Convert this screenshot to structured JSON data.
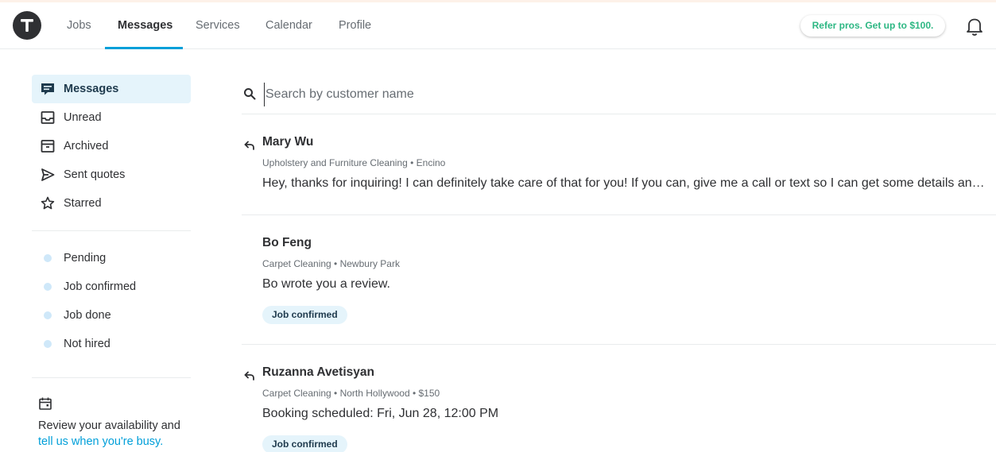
{
  "header": {
    "logo_letter": "T",
    "nav": [
      {
        "label": "Jobs",
        "active": false
      },
      {
        "label": "Messages",
        "active": true
      },
      {
        "label": "Services",
        "active": false
      },
      {
        "label": "Calendar",
        "active": false
      },
      {
        "label": "Profile",
        "active": false
      }
    ],
    "refer_label": "Refer pros. Get up to $100.",
    "bell_icon": "bell-icon"
  },
  "sidebar": {
    "folders": [
      {
        "label": "Messages",
        "icon": "message-icon",
        "active": true
      },
      {
        "label": "Unread",
        "icon": "inbox-icon",
        "active": false
      },
      {
        "label": "Archived",
        "icon": "archive-icon",
        "active": false
      },
      {
        "label": "Sent quotes",
        "icon": "send-icon",
        "active": false
      },
      {
        "label": "Starred",
        "icon": "star-icon",
        "active": false
      }
    ],
    "statuses": [
      {
        "label": "Pending"
      },
      {
        "label": "Job confirmed"
      },
      {
        "label": "Job done"
      },
      {
        "label": "Not hired"
      }
    ],
    "availability": {
      "text": "Review your availability and",
      "link": "tell us when you're busy."
    }
  },
  "search": {
    "placeholder": "Search by customer name",
    "value": ""
  },
  "conversations": [
    {
      "name": "Mary Wu",
      "replied": true,
      "meta": "Upholstery and Furniture Cleaning • Encino",
      "message": "Hey, thanks for inquiring! I can definitely take care of that for you! If you can, give me a call or text so I can get some details and provide you with a quote.",
      "badge": ""
    },
    {
      "name": "Bo Feng",
      "replied": false,
      "meta": "Carpet Cleaning • Newbury Park",
      "message": "Bo wrote you a review.",
      "badge": "Job confirmed"
    },
    {
      "name": "Ruzanna Avetisyan",
      "replied": true,
      "meta": "Carpet Cleaning • North Hollywood • $150",
      "message": "Booking scheduled: Fri, Jun 28, 12:00 PM",
      "badge": "Job confirmed"
    }
  ],
  "colors": {
    "accent": "#009fd9",
    "active_bg": "#e5f4fb",
    "refer_text": "#2db783",
    "status_dot": "#cfe8f9"
  }
}
